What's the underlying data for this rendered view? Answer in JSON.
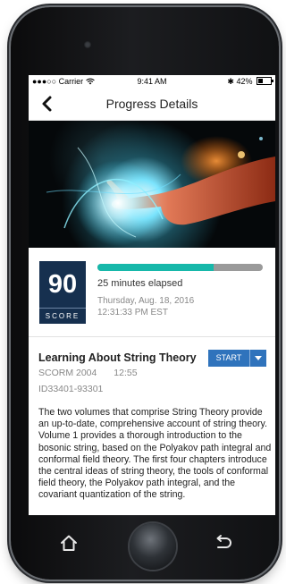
{
  "status_bar": {
    "carrier": "●●●○○ Carrier",
    "time": "9:41 AM",
    "bluetooth": "✱",
    "battery": "42%",
    "battery_level": 0.42
  },
  "nav": {
    "title": "Progress Details",
    "back_icon": "chevron-left-icon"
  },
  "progress": {
    "score": "90",
    "score_label": "SCORE",
    "fraction": 0.7,
    "elapsed": "25 minutes elapsed",
    "date": "Thursday, Aug. 18, 2016",
    "time": "12:31:33 PM EST"
  },
  "course": {
    "title": "Learning About String Theory",
    "start_label": "START",
    "format": "SCORM 2004",
    "duration": "12:55",
    "id": "ID33401-93301",
    "description": "The two volumes that comprise String Theory provide an up-to-date, comprehensive account of string theory. Volume 1 provides a thorough introduction to the bosonic string, based on the Polyakov path integral and conformal field theory. The first four chapters introduce the central ideas of string theory, the tools of conformal field theory, the Polyakov path integral, and the covariant quantization of the string."
  },
  "colors": {
    "score_bg": "#16304f",
    "progress_fill": "#17b8aa",
    "progress_track": "#9a9a9a",
    "button": "#2f73bc"
  },
  "device_controls": {
    "home_icon": "home-icon",
    "back_icon": "return-icon"
  }
}
